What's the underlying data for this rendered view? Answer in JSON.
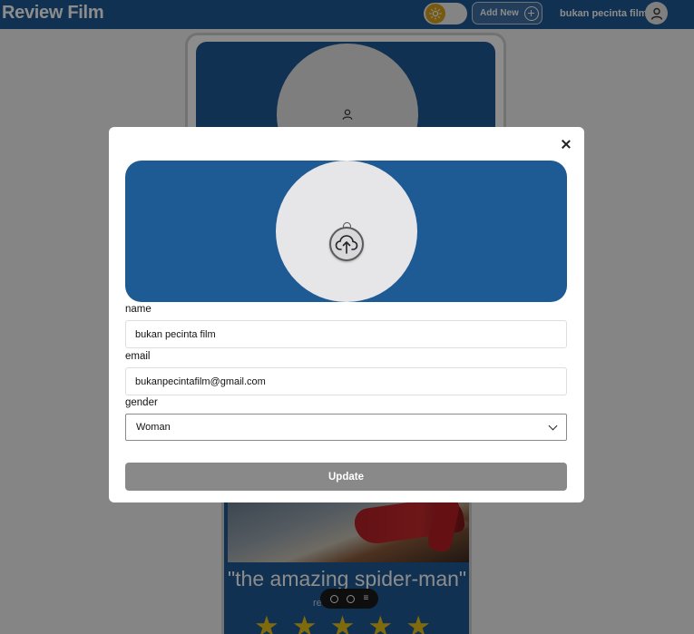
{
  "header": {
    "title": "Review Film",
    "add_new_label": "Add New",
    "user_name": "bukan pecinta film"
  },
  "background": {
    "film_title": "\"the amazing spider-man\"",
    "film_subtitle": "re 4",
    "rating_stars": 5
  },
  "modal": {
    "fields": {
      "name_label": "name",
      "name_value": "bukan pecinta film",
      "email_label": "email",
      "email_value": "bukanpecintafilm@gmail.com",
      "gender_label": "gender",
      "gender_value": "Woman"
    },
    "update_label": "Update"
  },
  "colors": {
    "brand": "#1e5a94",
    "star": "#e8c21a",
    "button_disabled": "#898989"
  },
  "icons": {
    "theme": "sun-icon",
    "add": "plus-circle-icon",
    "avatar": "user-icon",
    "close": "close-icon",
    "upload": "cloud-upload-icon"
  }
}
